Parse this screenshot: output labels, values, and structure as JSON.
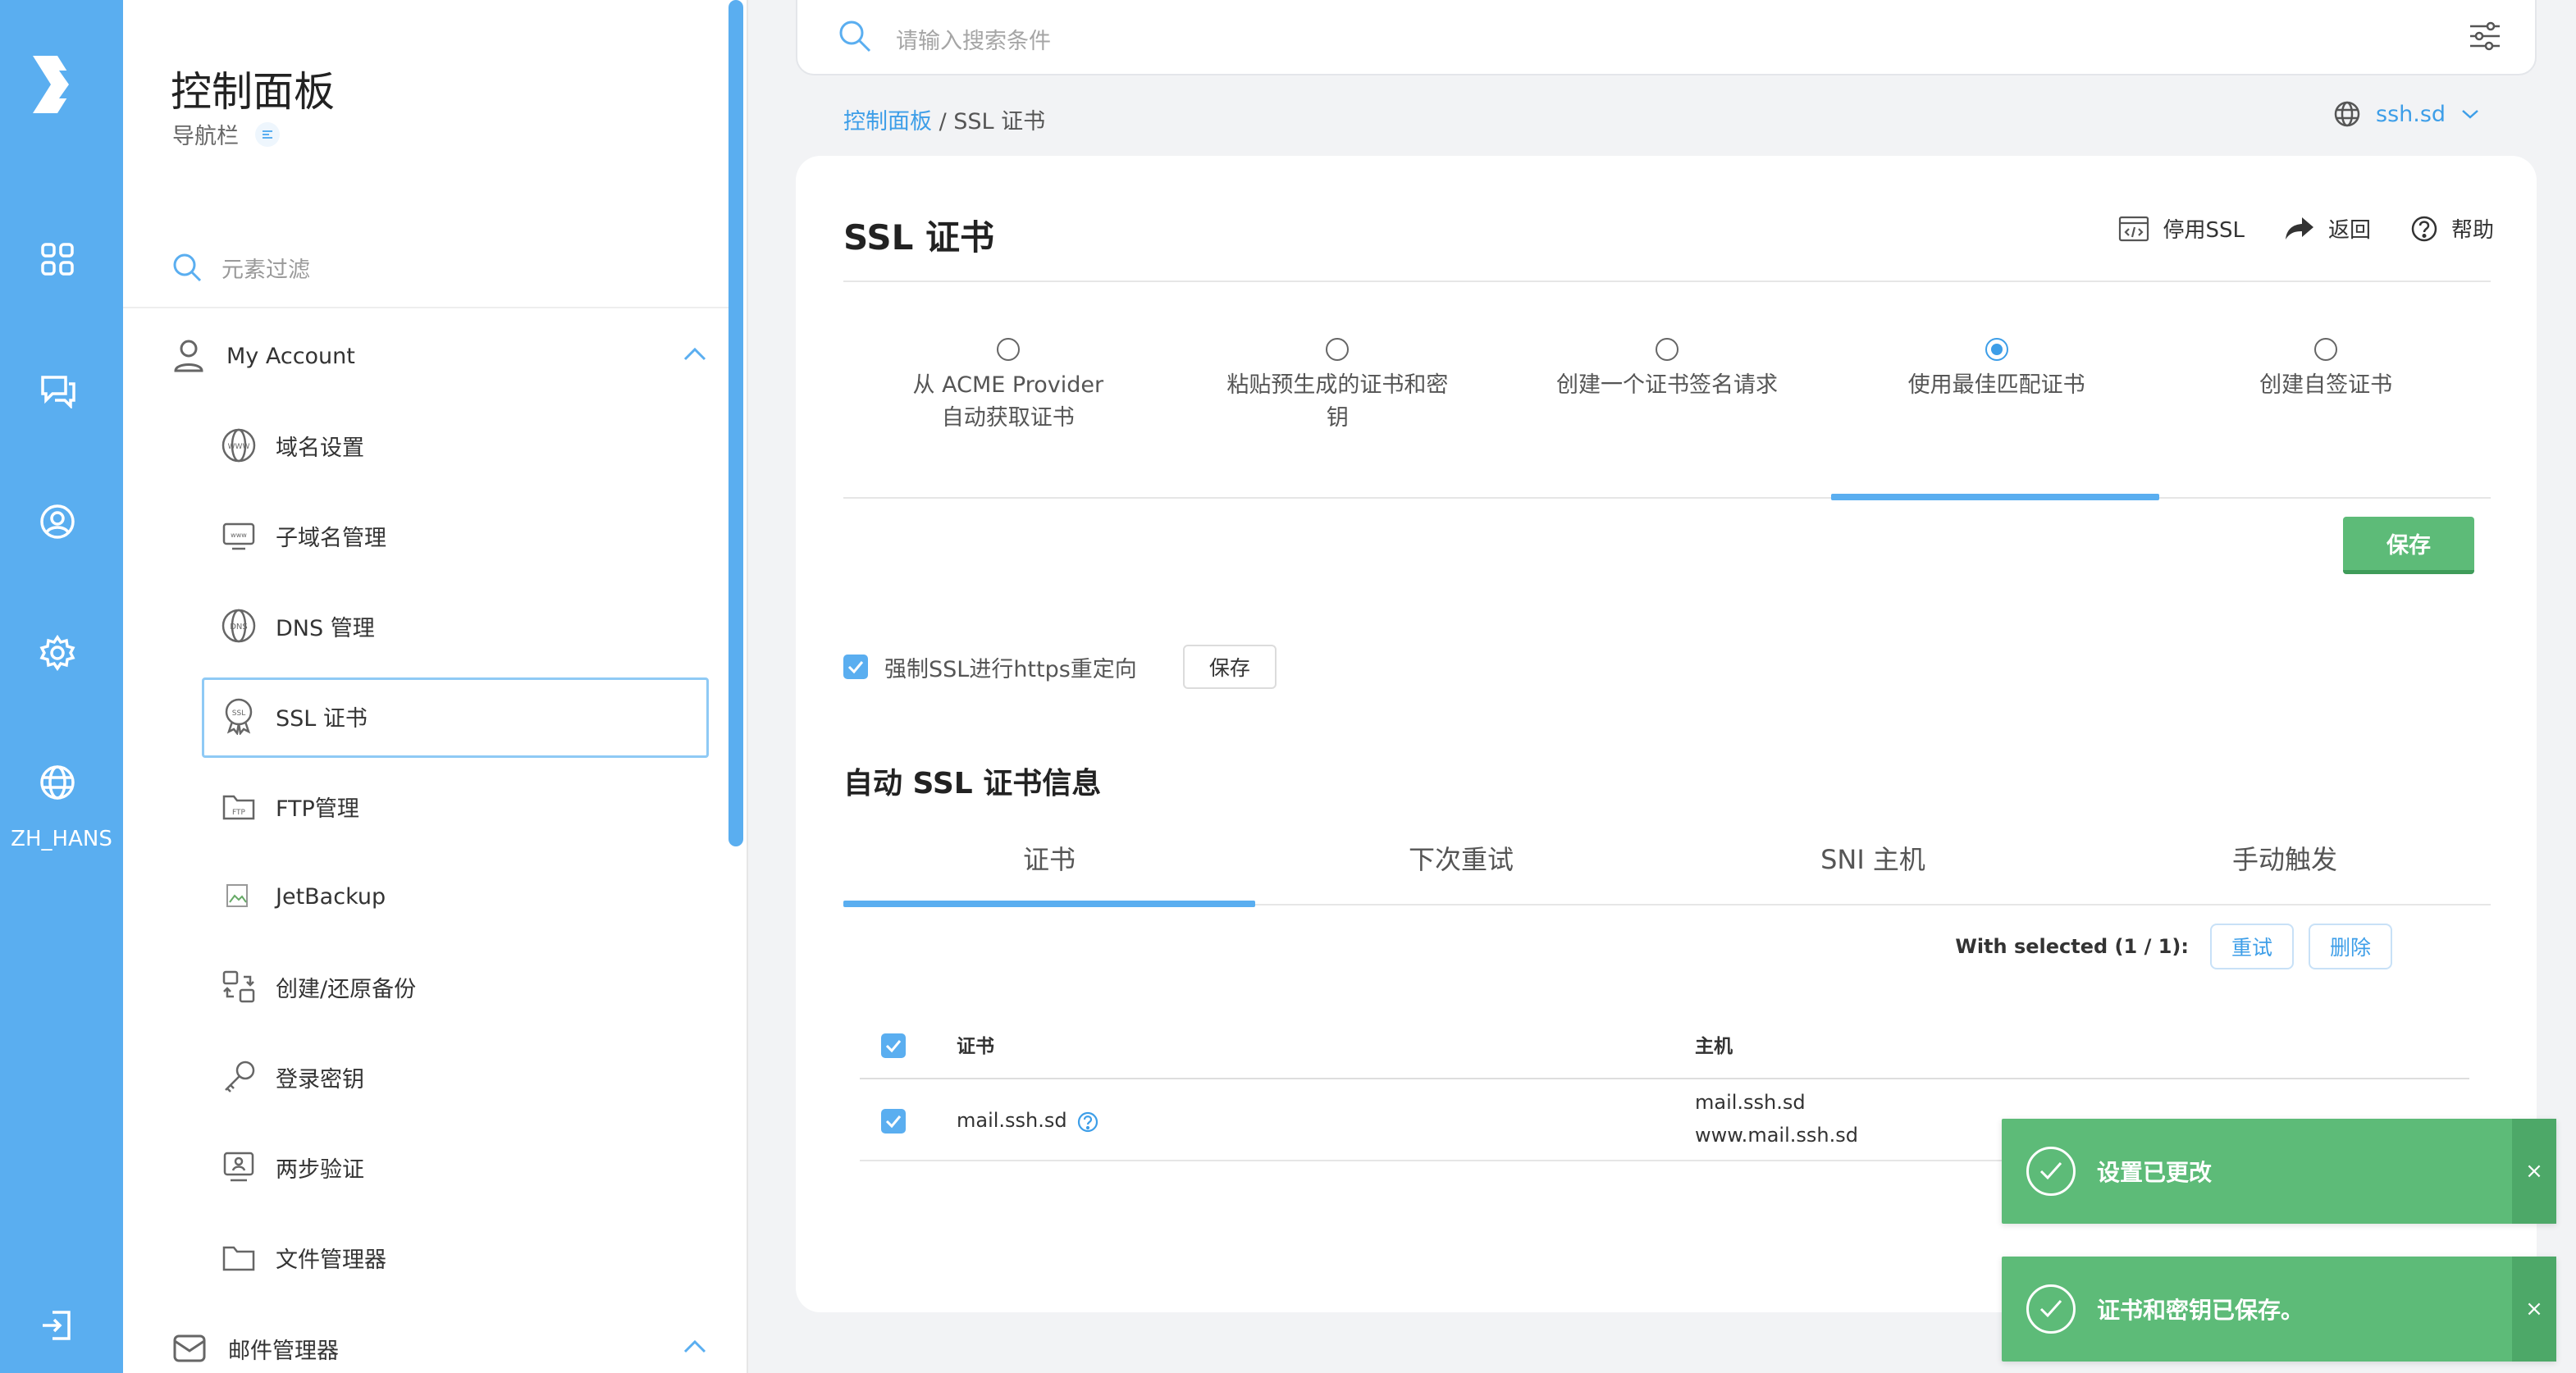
{
  "rail": {
    "language": "ZH_HANS",
    "icons": [
      "logo-icon",
      "dashboard-grid-icon",
      "chat-icon",
      "user-circle-icon",
      "gear-icon",
      "globe-icon",
      "logout-icon"
    ]
  },
  "sidebar": {
    "title": "控制面板",
    "subtitle": "导航栏",
    "filter_placeholder": "元素过滤",
    "group_account": "My Account",
    "items": [
      {
        "label": "域名设置",
        "icon": "www-icon"
      },
      {
        "label": "子域名管理",
        "icon": "subdomain-icon"
      },
      {
        "label": "DNS 管理",
        "icon": "dns-icon"
      },
      {
        "label": "SSL 证书",
        "icon": "ssl-badge-icon"
      },
      {
        "label": "FTP管理",
        "icon": "ftp-folder-icon"
      },
      {
        "label": "JetBackup",
        "icon": "broken-image-icon"
      },
      {
        "label": "创建/还原备份",
        "icon": "backup-icon"
      },
      {
        "label": "登录密钥",
        "icon": "key-icon"
      },
      {
        "label": "两步验证",
        "icon": "two-factor-icon"
      },
      {
        "label": "文件管理器",
        "icon": "folder-icon"
      }
    ],
    "group_mail": "邮件管理器"
  },
  "search": {
    "placeholder": "请输入搜索条件"
  },
  "breadcrumb": {
    "home": "控制面板",
    "separator": " / ",
    "current": "SSL 证书"
  },
  "domain_selector": {
    "value": "ssh.sd"
  },
  "page": {
    "title": "SSL 证书",
    "actions": {
      "disable": "停用SSL",
      "back": "返回",
      "help": "帮助"
    },
    "options": [
      {
        "line1": "从 ACME Provider",
        "line2": "自动获取证书",
        "selected": false
      },
      {
        "line1": "粘贴预生成的证书和密",
        "line2": "钥",
        "selected": false
      },
      {
        "line1": "创建一个证书签名请求",
        "line2": "",
        "selected": false
      },
      {
        "line1": "使用最佳匹配证书",
        "line2": "",
        "selected": true
      },
      {
        "line1": "创建自签证书",
        "line2": "",
        "selected": false
      }
    ],
    "save_label": "保存",
    "force_ssl_label": "强制SSL进行https重定向",
    "force_ssl_save": "保存",
    "section_title": "自动 SSL 证书信息",
    "tabs": [
      "证书",
      "下次重试",
      "SNI 主机",
      "手动触发"
    ],
    "with_selected": "With selected (1 / 1):",
    "retry_label": "重试",
    "delete_label": "删除",
    "table": {
      "headers": {
        "cert": "证书",
        "host": "主机"
      },
      "rows": [
        {
          "cert": "mail.ssh.sd",
          "hosts": [
            "mail.ssh.sd",
            "www.mail.ssh.sd"
          ],
          "checked": true
        }
      ]
    }
  },
  "toasts": [
    {
      "message": "设置已更改",
      "close": "×"
    },
    {
      "message": "证书和密钥已保存。",
      "close": "×"
    }
  ],
  "colors": {
    "accent": "#5aaef0",
    "link": "#3d9ee8",
    "success": "#5dbb78"
  }
}
